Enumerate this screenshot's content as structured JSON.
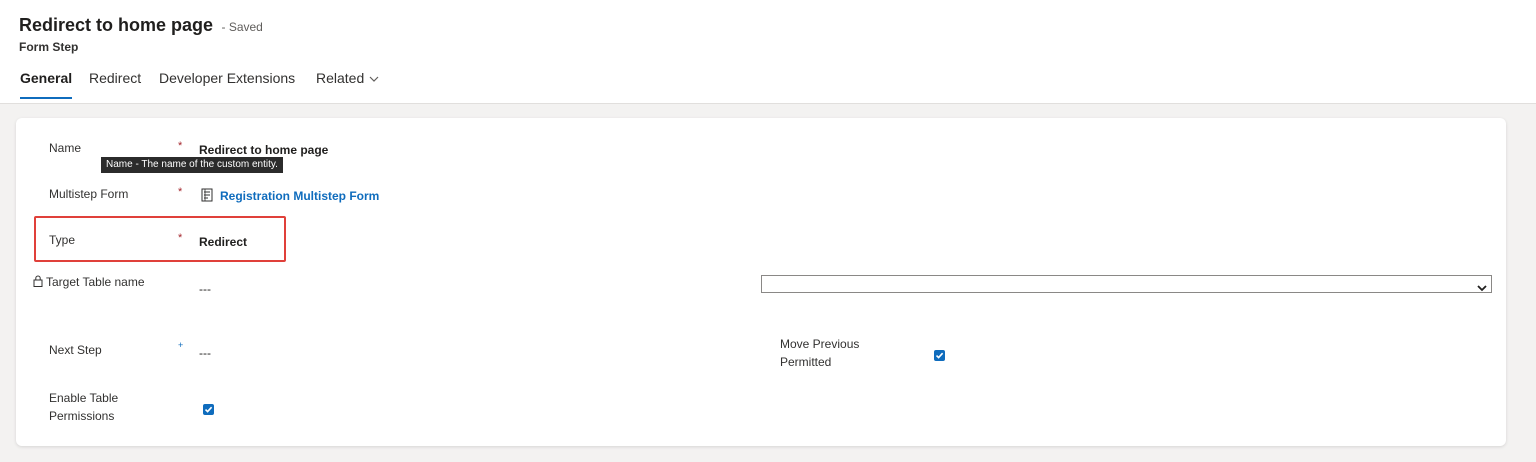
{
  "header": {
    "title": "Redirect to home page",
    "status": "- Saved",
    "entity_type": "Form Step"
  },
  "tabs": [
    {
      "label": "General",
      "active": true
    },
    {
      "label": "Redirect",
      "active": false
    },
    {
      "label": "Developer Extensions",
      "active": false
    },
    {
      "label": "Related",
      "active": false,
      "has_dropdown": true
    }
  ],
  "form": {
    "name": {
      "label": "Name",
      "required": "*",
      "value": "Redirect to home page",
      "tooltip": "Name - The name of the custom entity."
    },
    "multistep_form": {
      "label": "Multistep Form",
      "required": "*",
      "value": "Registration Multistep Form",
      "icon": "record-icon"
    },
    "type": {
      "label": "Type",
      "required": "*",
      "value": "Redirect"
    },
    "target_table": {
      "label": "Target Table name",
      "value": "---",
      "icon": "lock-icon",
      "select_value": ""
    },
    "next_step": {
      "label": "Next Step",
      "required": "+",
      "value": "---"
    },
    "move_previous": {
      "label_line1": "Move Previous",
      "label_line2": "Permitted",
      "checked": true
    },
    "enable_permissions": {
      "label_line1": "Enable Table",
      "label_line2": "Permissions",
      "checked": true
    }
  },
  "colors": {
    "accent": "#0f6cbd",
    "required": "#a4262c",
    "highlight_box": "#e0403a"
  }
}
